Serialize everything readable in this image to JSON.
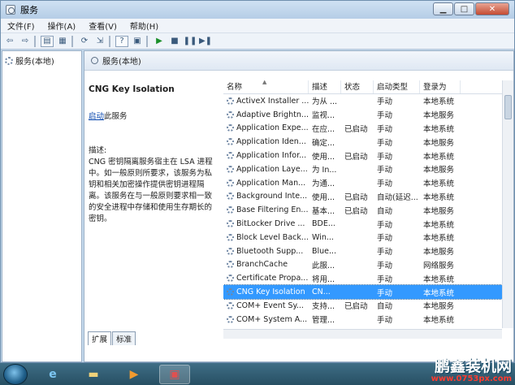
{
  "window": {
    "title": "服务"
  },
  "menu": [
    "文件(F)",
    "操作(A)",
    "查看(V)",
    "帮助(H)"
  ],
  "tree": {
    "root": "服务(本地)"
  },
  "panel": {
    "header": "服务(本地)"
  },
  "description": {
    "service_name": "CNG Key Isolation",
    "start_link": "启动",
    "start_suffix": "此服务",
    "desc_label": "描述:",
    "desc_text": "CNG 密钥隔离服务宿主在 LSA 进程中。如一般原则所要求，该服务为私钥和相关加密操作提供密钥进程隔离。该服务在与一般原则要求相一致的安全进程中存储和使用生存期长的密钥。"
  },
  "columns": [
    "名称",
    "描述",
    "状态",
    "启动类型",
    "登录为"
  ],
  "rows": [
    [
      "ActiveX Installer ...",
      "为从 ...",
      "",
      "手动",
      "本地系统"
    ],
    [
      "Adaptive Brightn...",
      "监视...",
      "",
      "手动",
      "本地服务"
    ],
    [
      "Application Expe...",
      "在应...",
      "已启动",
      "手动",
      "本地系统"
    ],
    [
      "Application Iden...",
      "确定...",
      "",
      "手动",
      "本地服务"
    ],
    [
      "Application Infor...",
      "使用...",
      "已启动",
      "手动",
      "本地系统"
    ],
    [
      "Application Laye...",
      "为 In...",
      "",
      "手动",
      "本地服务"
    ],
    [
      "Application Man...",
      "为通...",
      "",
      "手动",
      "本地系统"
    ],
    [
      "Background Inte...",
      "使用...",
      "已启动",
      "自动(延迟...",
      "本地系统"
    ],
    [
      "Base Filtering En...",
      "基本...",
      "已启动",
      "自动",
      "本地服务"
    ],
    [
      "BitLocker Drive ...",
      "BDE...",
      "",
      "手动",
      "本地系统"
    ],
    [
      "Block Level Back...",
      "Win...",
      "",
      "手动",
      "本地系统"
    ],
    [
      "Bluetooth Supp...",
      "Blue...",
      "",
      "手动",
      "本地服务"
    ],
    [
      "BranchCache",
      "此服...",
      "",
      "手动",
      "网络服务"
    ],
    [
      "Certificate Propa...",
      "将用...",
      "",
      "手动",
      "本地系统"
    ],
    [
      "CNG Key Isolation",
      "CN...",
      "",
      "手动",
      "本地系统"
    ],
    [
      "COM+ Event Sy...",
      "支持...",
      "已启动",
      "自动",
      "本地服务"
    ],
    [
      "COM+ System A...",
      "管理...",
      "",
      "手动",
      "本地系统"
    ]
  ],
  "selected_row": 14,
  "tabs": [
    "扩展",
    "标准"
  ],
  "watermark": {
    "brand": "鹏鑫装机网",
    "url": "www.0753px.com"
  }
}
